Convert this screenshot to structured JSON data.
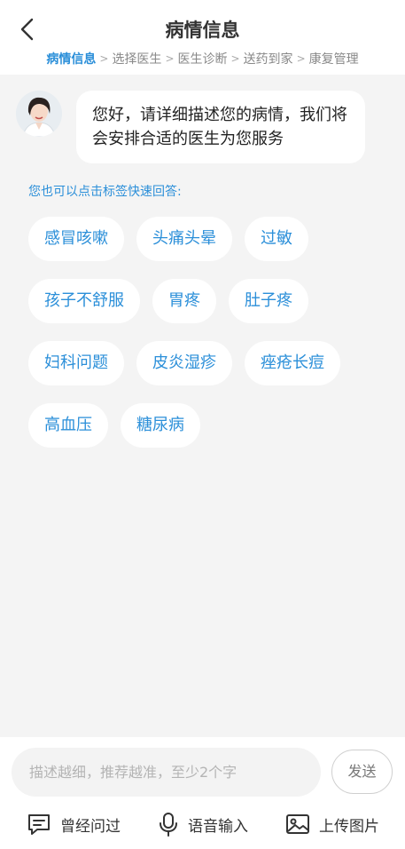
{
  "header": {
    "title": "病情信息",
    "steps": [
      "病情信息",
      "选择医生",
      "医生诊断",
      "送药到家",
      "康复管理"
    ],
    "step_separator": ">"
  },
  "chat": {
    "message": "您好，请详细描述您的病情，我们将会安排合适的医生为您服务"
  },
  "quick_reply": {
    "hint": "您也可以点击标签快速回答:",
    "tags": [
      [
        "感冒咳嗽",
        "头痛头晕",
        "过敏"
      ],
      [
        "孩子不舒服",
        "胃疼",
        "肚子疼"
      ],
      [
        "妇科问题",
        "皮炎湿疹",
        "痤疮长痘"
      ],
      [
        "高血压",
        "糖尿病"
      ]
    ]
  },
  "composer": {
    "placeholder": "描述越细，推荐越准，至少2个字",
    "send_label": "发送"
  },
  "actions": {
    "history_label": "曾经问过",
    "voice_label": "语音输入",
    "upload_label": "上传图片"
  },
  "colors": {
    "accent": "#2b8fd9",
    "background": "#f4f4f4"
  }
}
